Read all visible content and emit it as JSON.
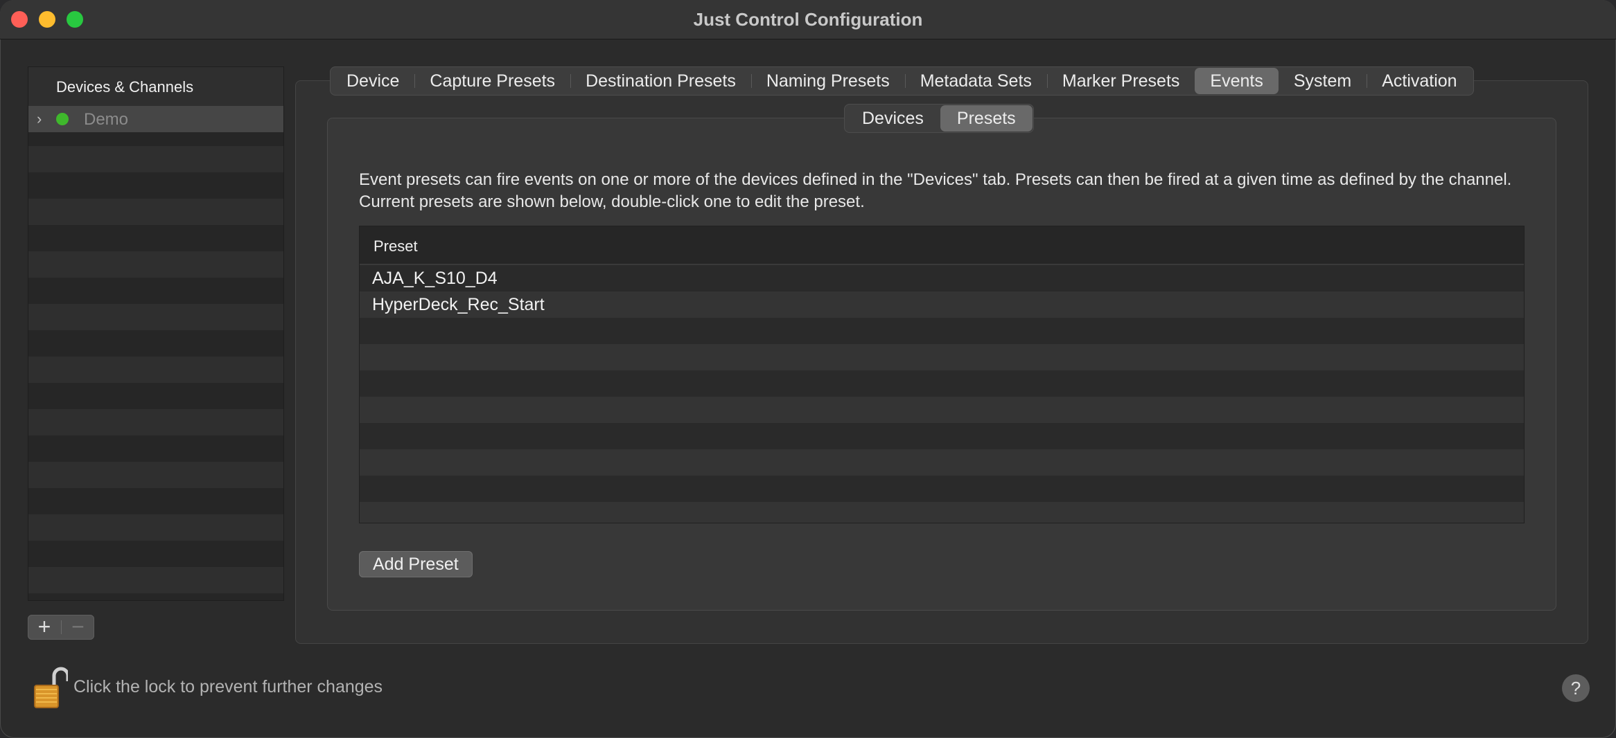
{
  "window": {
    "title": "Just Control Configuration"
  },
  "sidebar": {
    "header": "Devices & Channels",
    "items": [
      {
        "label": "Demo",
        "status_color": "#3fb82c"
      }
    ],
    "add_label": "+",
    "remove_label": "−"
  },
  "tabs": [
    {
      "label": "Device"
    },
    {
      "label": "Capture Presets"
    },
    {
      "label": "Destination Presets"
    },
    {
      "label": "Naming Presets"
    },
    {
      "label": "Metadata Sets"
    },
    {
      "label": "Marker Presets"
    },
    {
      "label": "Events",
      "selected": true
    },
    {
      "label": "System"
    },
    {
      "label": "Activation"
    }
  ],
  "subtabs": [
    {
      "label": "Devices"
    },
    {
      "label": "Presets",
      "selected": true
    }
  ],
  "presets_pane": {
    "description": "Event presets can fire events on one or more of the devices defined in the \"Devices\" tab. Presets can then be fired at a given time as defined by the channel. Current presets are shown below, double-click one to edit the preset.",
    "table": {
      "column_header": "Preset",
      "rows": [
        "AJA_K_S10_D4",
        "HyperDeck_Rec_Start"
      ]
    },
    "add_button": "Add Preset"
  },
  "footer": {
    "lock_text": "Click the lock to prevent further changes",
    "help_label": "?"
  }
}
